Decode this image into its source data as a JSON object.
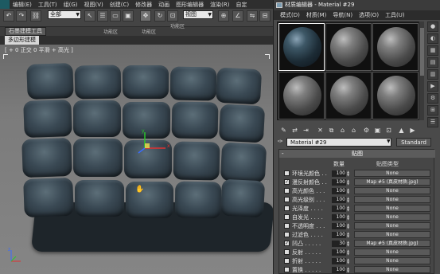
{
  "app": {
    "menu": [
      "编辑(E)",
      "工具(T)",
      "组(G)",
      "视图(V)",
      "创建(C)",
      "修改器",
      "动画",
      "图形编辑器",
      "渲染(R)",
      "自定"
    ],
    "toolbar": {
      "selection_filter": "全部",
      "coord_system": "视图"
    },
    "ribbon": {
      "tab": "石墨建模工具",
      "subtab": "多边形建模",
      "mini_labels": [
        "功能区",
        "功能区",
        "功能区"
      ]
    },
    "viewport": {
      "label": "[ + 0 正交 0 平滑 + 高光 ]",
      "axis_labels": {
        "x": "x",
        "y": "y",
        "z": "z"
      }
    }
  },
  "material_editor": {
    "title": "材质编辑器 - Material #29",
    "menu": [
      "模式(D)",
      "材质(M)",
      "导航(N)",
      "选项(O)",
      "工具(U)"
    ],
    "slot_count": 6,
    "active_slot": 0,
    "name_field": "Material #29",
    "type_button": "Standard",
    "maps": {
      "header": "贴图",
      "minus": "-",
      "col_amount": "数量",
      "col_type": "贴图类型",
      "rows": [
        {
          "checked": false,
          "label": "环境光颜色 . .",
          "amount": "100",
          "map": "None"
        },
        {
          "checked": true,
          "label": "漫反射颜色 . .",
          "amount": "100",
          "map": "Map #5 (真皮材质.jpg)"
        },
        {
          "checked": false,
          "label": "高光颜色 . . .",
          "amount": "100",
          "map": "None"
        },
        {
          "checked": false,
          "label": "高光级别 . . .",
          "amount": "100",
          "map": "None"
        },
        {
          "checked": false,
          "label": "光泽度 . . . .",
          "amount": "100",
          "map": "None"
        },
        {
          "checked": false,
          "label": "自发光 . . . .",
          "amount": "100",
          "map": "None"
        },
        {
          "checked": false,
          "label": "不透明度 . . .",
          "amount": "100",
          "map": "None"
        },
        {
          "checked": false,
          "label": "过滤色 . . . .",
          "amount": "100",
          "map": "None"
        },
        {
          "checked": true,
          "label": "凹凸 . . . . .",
          "amount": "30",
          "map": "Map #5 (真皮材质.jpg)"
        },
        {
          "checked": false,
          "label": "反射 . . . . .",
          "amount": "100",
          "map": "None"
        },
        {
          "checked": false,
          "label": "折射 . . . . .",
          "amount": "100",
          "map": "None"
        },
        {
          "checked": false,
          "label": "置换 . . . . .",
          "amount": "100",
          "map": "None"
        }
      ]
    }
  }
}
